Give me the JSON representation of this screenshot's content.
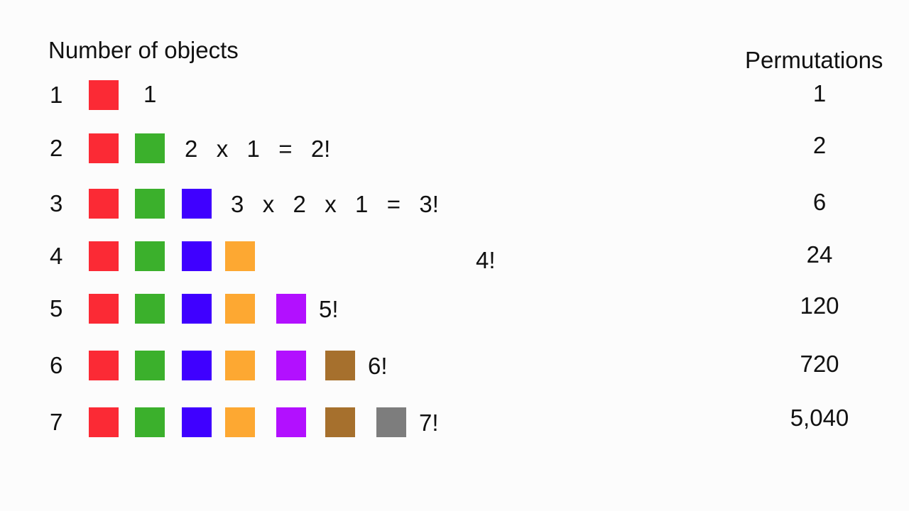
{
  "left_heading": "Number of objects",
  "right_heading": "Permutations",
  "colors": {
    "red": "#fb2a35",
    "green": "#3bb02c",
    "blue": "#3f00ff",
    "orange": "#fda832",
    "purple": "#b210ff",
    "brown": "#a6702d",
    "gray": "#7d7d7d"
  },
  "rows": [
    {
      "n": "1",
      "objects": [
        "red"
      ],
      "expression": "1",
      "permutations": "1"
    },
    {
      "n": "2",
      "objects": [
        "red",
        "green"
      ],
      "expression": "2  x  1  =  2!",
      "permutations": "2"
    },
    {
      "n": "3",
      "objects": [
        "red",
        "green",
        "blue"
      ],
      "expression": "3  x  2  x  1  =  3!",
      "permutations": "6"
    },
    {
      "n": "4",
      "objects": [
        "red",
        "green",
        "blue",
        "orange"
      ],
      "expression": "4!",
      "permutations": "24"
    },
    {
      "n": "5",
      "objects": [
        "red",
        "green",
        "blue",
        "orange",
        "purple"
      ],
      "expression": "5!",
      "permutations": "120"
    },
    {
      "n": "6",
      "objects": [
        "red",
        "green",
        "blue",
        "orange",
        "purple",
        "brown"
      ],
      "expression": "6!",
      "permutations": "720"
    },
    {
      "n": "7",
      "objects": [
        "red",
        "green",
        "blue",
        "orange",
        "purple",
        "brown",
        "gray"
      ],
      "expression": "7!",
      "permutations": "5,040"
    }
  ]
}
